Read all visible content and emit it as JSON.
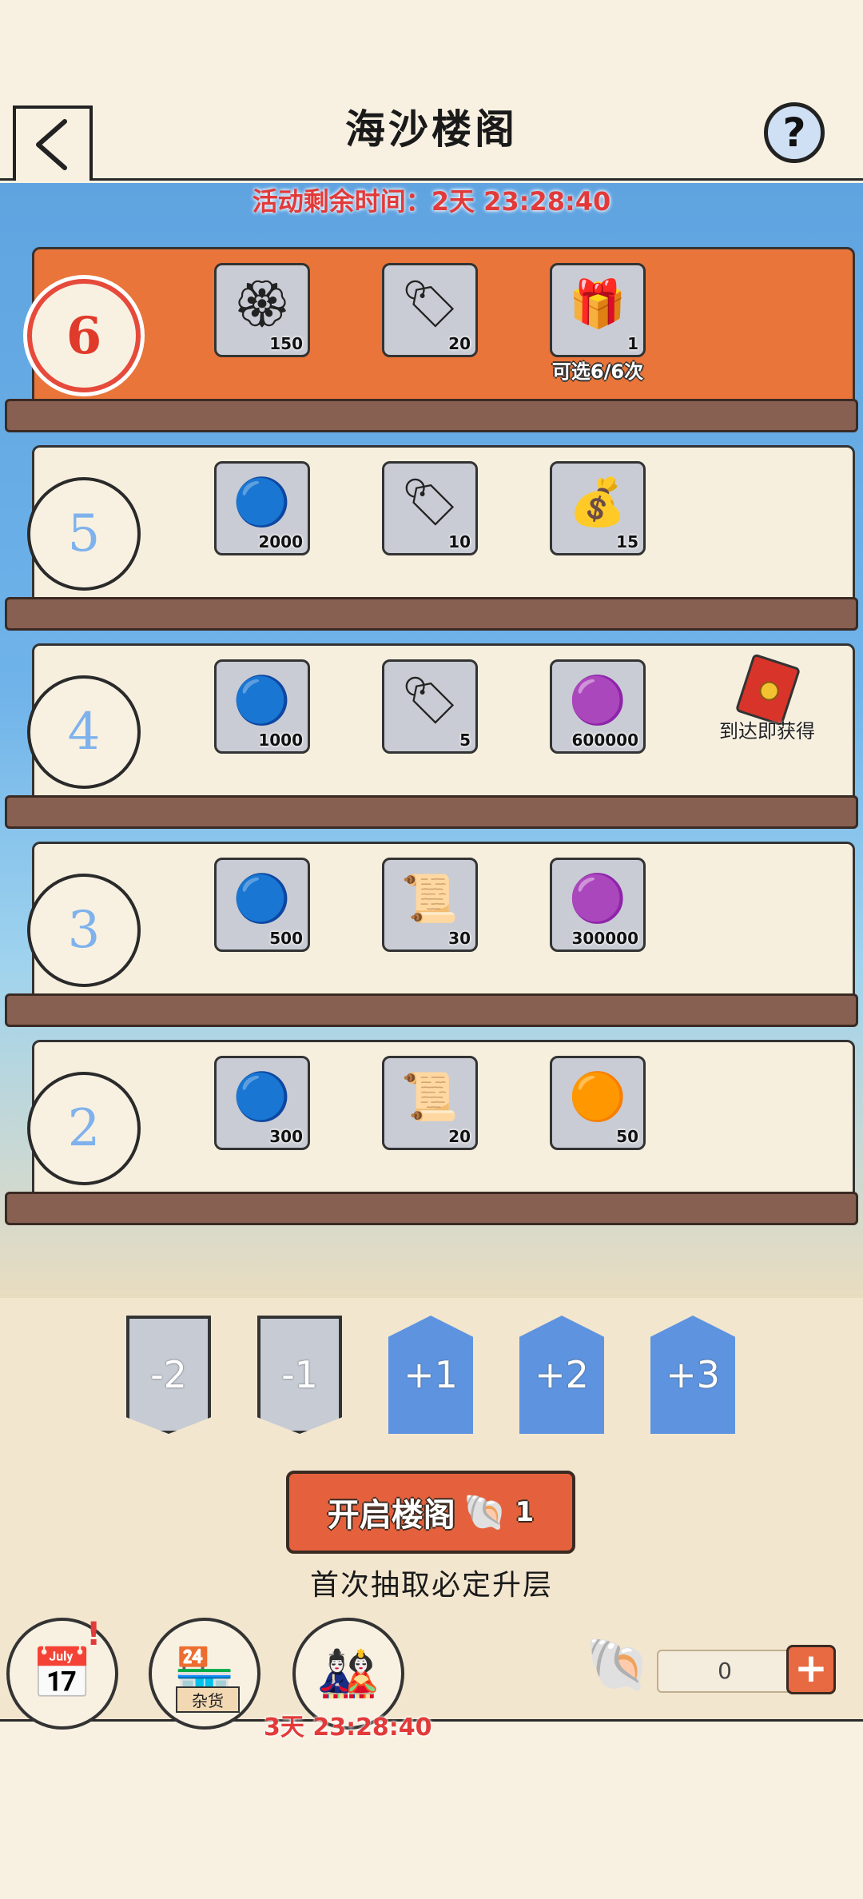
{
  "header": {
    "title": "海沙楼阁"
  },
  "activity_timer": "活动剩余时间：2天 23:28:40",
  "floors": [
    {
      "level": "6",
      "active": true,
      "items": [
        {
          "icon": "golden-token-icon",
          "glyph": "🏵",
          "qty": "150"
        },
        {
          "icon": "blue-tag-icon",
          "glyph": "🏷",
          "qty": "20"
        },
        {
          "icon": "gift-box-icon",
          "glyph": "🎁",
          "qty": "1"
        }
      ],
      "note": "可选6/6次"
    },
    {
      "level": "5",
      "items": [
        {
          "icon": "blue-coin-icon",
          "glyph": "🔵",
          "qty": "2000"
        },
        {
          "icon": "blue-tag-icon",
          "glyph": "🏷",
          "qty": "10"
        },
        {
          "icon": "money-bag-icon",
          "glyph": "💰",
          "qty": "15"
        }
      ]
    },
    {
      "level": "4",
      "items": [
        {
          "icon": "blue-coin-icon",
          "glyph": "🔵",
          "qty": "1000"
        },
        {
          "icon": "blue-tag-icon",
          "glyph": "🏷",
          "qty": "5"
        },
        {
          "icon": "purple-orb-icon",
          "glyph": "🟣",
          "qty": "600000"
        }
      ],
      "reward_label": "到达即获得"
    },
    {
      "level": "3",
      "items": [
        {
          "icon": "blue-coin-icon",
          "glyph": "🔵",
          "qty": "500"
        },
        {
          "icon": "paper-scroll-icon",
          "glyph": "📜",
          "qty": "30"
        },
        {
          "icon": "purple-orb-icon",
          "glyph": "🟣",
          "qty": "300000"
        }
      ]
    },
    {
      "level": "2",
      "items": [
        {
          "icon": "blue-coin-icon",
          "glyph": "🔵",
          "qty": "300"
        },
        {
          "icon": "paper-scroll-icon",
          "glyph": "📜",
          "qty": "20"
        },
        {
          "icon": "orange-gem-cloth-icon",
          "glyph": "🟠",
          "qty": "50"
        }
      ]
    }
  ],
  "step_buttons": [
    "-2",
    "-1",
    "+1",
    "+2",
    "+3"
  ],
  "open_button": {
    "label": "开启楼阁",
    "cost": "1"
  },
  "hint": "首次抽取必定升层",
  "nav": {
    "badge": "!",
    "shop_label": "杂货",
    "event_timer": "3天 23:28:40"
  },
  "shell_count": "0",
  "colors": {
    "accent_orange": "#e9753a",
    "timer_red": "#e23a3a",
    "step_blue": "#5e94df",
    "step_grey": "#c6cbd4",
    "shelf_brown": "#876052"
  }
}
